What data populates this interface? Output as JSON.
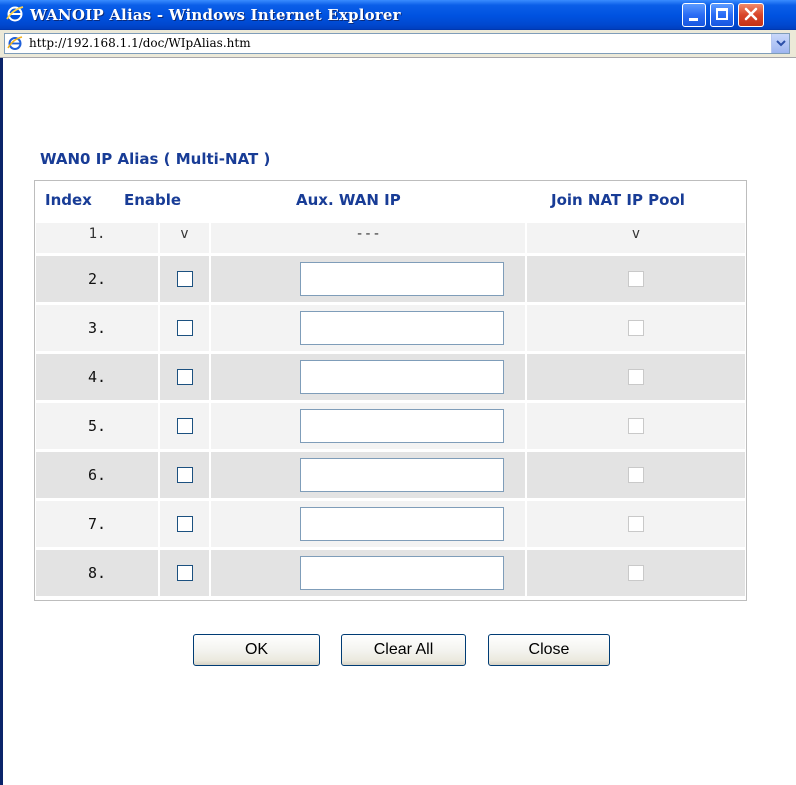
{
  "window": {
    "title": "WANOIP Alias - Windows Internet Explorer",
    "icon": "ie-icon",
    "controls": [
      "minimize-icon",
      "maximize-icon",
      "close-icon"
    ]
  },
  "address_bar": {
    "url": "http://192.168.1.1/doc/WIpAlias.htm"
  },
  "page": {
    "section_title": "WAN0 IP Alias ( Multi-NAT )",
    "headers": {
      "index": "Index",
      "enable": "Enable",
      "aux_wan_ip": "Aux. WAN IP",
      "join_nat": "Join NAT IP Pool"
    },
    "row1": {
      "index": "1.",
      "enable": "v",
      "aux_wan_ip": "---",
      "join_nat": "v"
    },
    "rows": [
      {
        "index": "2.",
        "enabled": false,
        "aux_wan_ip": "",
        "join_nat": false
      },
      {
        "index": "3.",
        "enabled": false,
        "aux_wan_ip": "",
        "join_nat": false
      },
      {
        "index": "4.",
        "enabled": false,
        "aux_wan_ip": "",
        "join_nat": false
      },
      {
        "index": "5.",
        "enabled": false,
        "aux_wan_ip": "",
        "join_nat": false
      },
      {
        "index": "6.",
        "enabled": false,
        "aux_wan_ip": "",
        "join_nat": false
      },
      {
        "index": "7.",
        "enabled": false,
        "aux_wan_ip": "",
        "join_nat": false
      },
      {
        "index": "8.",
        "enabled": false,
        "aux_wan_ip": "",
        "join_nat": false
      }
    ],
    "buttons": {
      "ok": "OK",
      "clear_all": "Clear All",
      "close": "Close"
    }
  },
  "colors": {
    "accent": "#183c96",
    "titlebar": "#0052e0",
    "row_shaded": "#e3e3e3",
    "row_light": "#f3f3f3"
  }
}
